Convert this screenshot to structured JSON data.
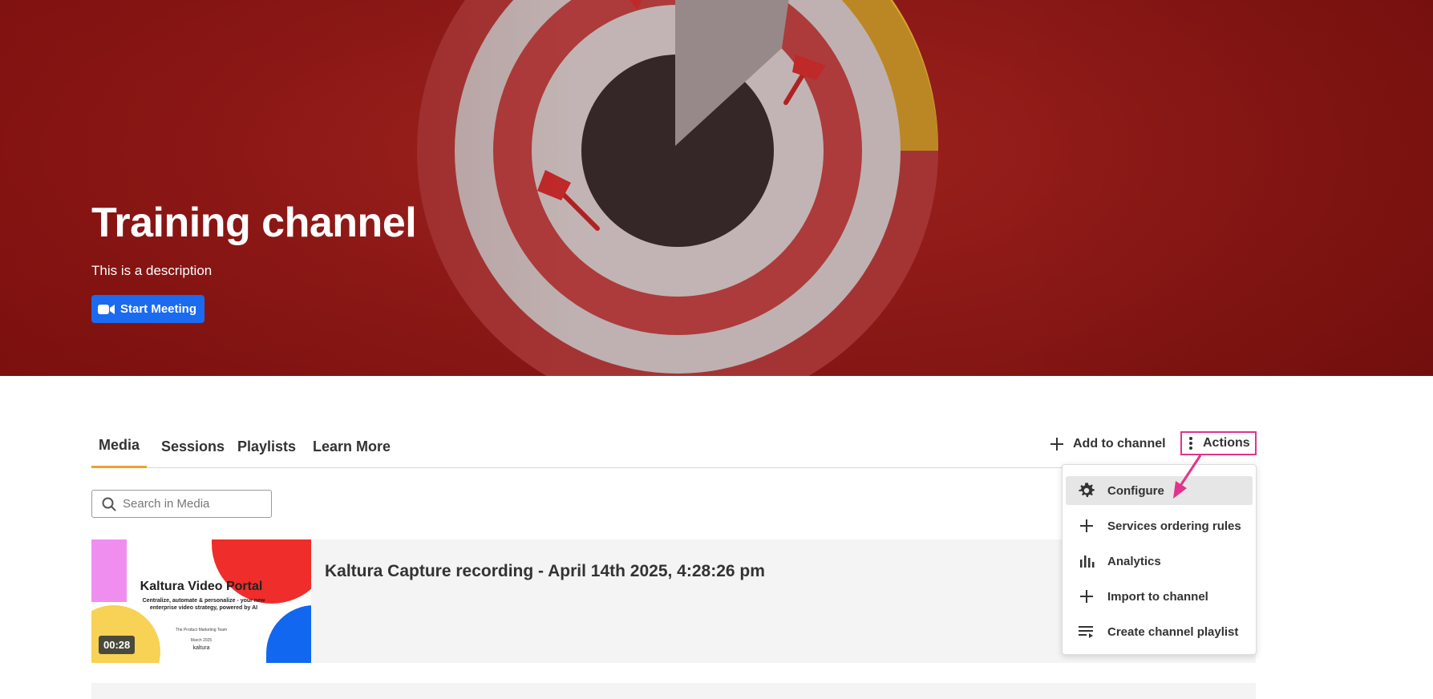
{
  "hero": {
    "title": "Training channel",
    "description": "This is a description",
    "start_meeting_label": "Start Meeting"
  },
  "tabs": [
    {
      "label": "Media",
      "active": true
    },
    {
      "label": "Sessions",
      "active": false
    },
    {
      "label": "Playlists",
      "active": false
    },
    {
      "label": "Learn More",
      "active": false
    }
  ],
  "toolbar": {
    "add_to_channel_label": "Add to channel",
    "actions_label": "Actions"
  },
  "search": {
    "placeholder": "Search in Media",
    "value": ""
  },
  "media_entries": [
    {
      "title": "Kaltura Capture recording - April 14th 2025, 4:28:26 pm",
      "duration": "00:28",
      "thumbnail": {
        "headline": "Kaltura Video Portal",
        "subline": "Centralize, automate & personalize - your new enterprise video strategy, powered by AI",
        "team": "The Product Marketing Team",
        "date": "March 2025",
        "logo_text": "kaltura"
      }
    }
  ],
  "actions_menu": {
    "items": [
      {
        "label": "Configure",
        "icon": "gear-icon",
        "highlighted": true
      },
      {
        "label": "Services ordering rules",
        "icon": "plus-icon",
        "highlighted": false
      },
      {
        "label": "Analytics",
        "icon": "bar-chart-icon",
        "highlighted": false
      },
      {
        "label": "Import to channel",
        "icon": "plus-icon",
        "highlighted": false
      },
      {
        "label": "Create channel playlist",
        "icon": "playlist-add-icon",
        "highlighted": false
      }
    ]
  },
  "colors": {
    "accent_blue": "#1a6bf0",
    "tab_underline": "#f0a030",
    "annotation_pink": "#e0348c",
    "hero_red": "#8e1a17"
  }
}
